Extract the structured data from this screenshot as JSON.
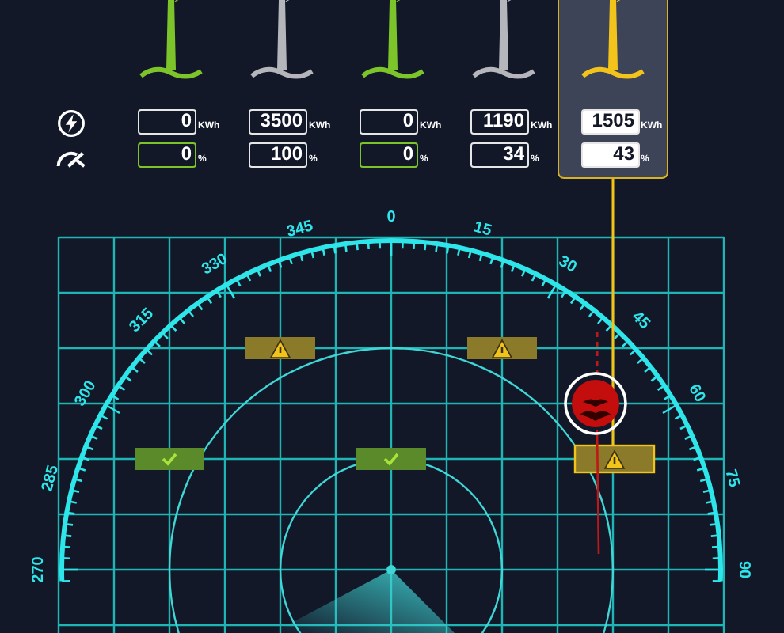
{
  "turbines": [
    {
      "kind": "running",
      "selected": false,
      "power": "0",
      "power_unit": "KWh",
      "speed": "0",
      "speed_unit": "%"
    },
    {
      "kind": "idle",
      "selected": false,
      "power": "3500",
      "power_unit": "KWh",
      "speed": "100",
      "speed_unit": "%"
    },
    {
      "kind": "running",
      "selected": false,
      "power": "0",
      "power_unit": "KWh",
      "speed": "0",
      "speed_unit": "%"
    },
    {
      "kind": "idle",
      "selected": false,
      "power": "1190",
      "power_unit": "KWh",
      "speed": "34",
      "speed_unit": "%"
    },
    {
      "kind": "warning",
      "selected": true,
      "power": "1505",
      "power_unit": "KWh",
      "speed": "43",
      "speed_unit": "%"
    }
  ],
  "radar": {
    "dial_labels": [
      "270",
      "285",
      "300",
      "315",
      "330",
      "345",
      "0",
      "15",
      "30",
      "45",
      "60",
      "75",
      "90"
    ],
    "markers": [
      {
        "kind": "warning"
      },
      {
        "kind": "warning"
      },
      {
        "kind": "ok"
      },
      {
        "kind": "ok"
      },
      {
        "kind": "warning"
      }
    ]
  }
}
